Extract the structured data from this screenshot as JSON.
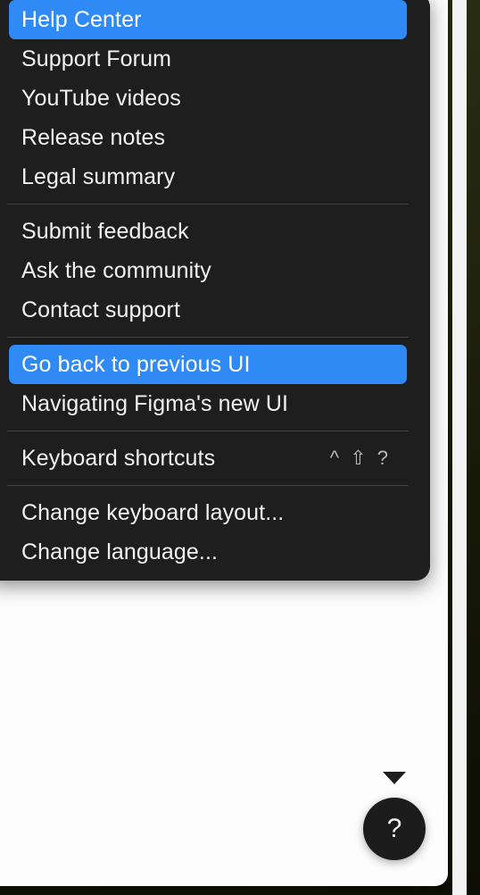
{
  "colors": {
    "menu_bg": "#1e1e1e",
    "highlight_blue": "#2f8af5",
    "menu_text": "#f2f2f2",
    "separator": "#434343",
    "shortcut_text": "#b8b8b8",
    "panel_bg": "#fdfdfd",
    "fab_bg": "#1c1c1c",
    "scrollbar_thumb": "#9b9b9b"
  },
  "help_menu": {
    "groups": [
      {
        "items": [
          {
            "label": "Help Center",
            "selected": true,
            "shortcut": ""
          },
          {
            "label": "Support Forum",
            "selected": false,
            "shortcut": ""
          },
          {
            "label": "YouTube videos",
            "selected": false,
            "shortcut": ""
          },
          {
            "label": "Release notes",
            "selected": false,
            "shortcut": ""
          },
          {
            "label": "Legal summary",
            "selected": false,
            "shortcut": ""
          }
        ]
      },
      {
        "items": [
          {
            "label": "Submit feedback",
            "selected": false,
            "shortcut": ""
          },
          {
            "label": "Ask the community",
            "selected": false,
            "shortcut": ""
          },
          {
            "label": "Contact support",
            "selected": false,
            "shortcut": ""
          }
        ]
      },
      {
        "items": [
          {
            "label": "Go back to previous UI",
            "selected": true,
            "shortcut": ""
          },
          {
            "label": "Navigating Figma's new UI",
            "selected": false,
            "shortcut": ""
          }
        ]
      },
      {
        "items": [
          {
            "label": "Keyboard shortcuts",
            "selected": false,
            "shortcut": "^ ⇧ ?"
          }
        ]
      },
      {
        "items": [
          {
            "label": "Change keyboard layout...",
            "selected": false,
            "shortcut": ""
          },
          {
            "label": "Change language...",
            "selected": false,
            "shortcut": ""
          }
        ]
      }
    ]
  },
  "help_button": {
    "glyph": "?",
    "icon_name": "question-mark-icon"
  },
  "scrollbar": {
    "orientation": "vertical"
  }
}
